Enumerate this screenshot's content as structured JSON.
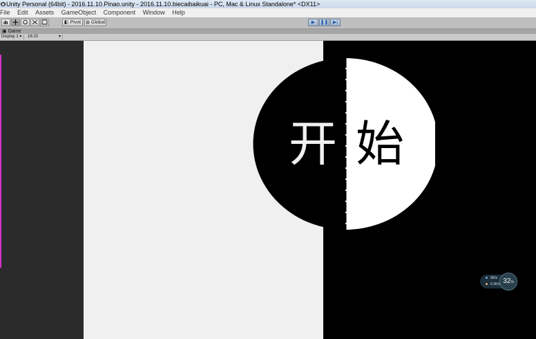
{
  "window": {
    "title": "Unity Personal (64bit) - 2016.11.10.Pinao.unity - 2016.11.10.biecaibaikuai - PC, Mac & Linux Standalone* <DX11>"
  },
  "menu": [
    "File",
    "Edit",
    "Assets",
    "GameObject",
    "Component",
    "Window",
    "Help"
  ],
  "toolbar": {
    "pivot_label": "Pivot",
    "global_label": "Global",
    "tools": [
      "hand-icon",
      "move-icon",
      "rotate-icon",
      "scale-icon",
      "rect-icon"
    ],
    "playback": [
      "play-icon",
      "pause-icon",
      "step-icon"
    ]
  },
  "game_view": {
    "tab_label": "Game",
    "display_label": "Display 1",
    "aspect_label": "16:10"
  },
  "scene": {
    "button_left_char": "开",
    "button_right_char": "始",
    "colors": {
      "dark": "#000000",
      "light": "#f0f0f0",
      "white": "#ffffff",
      "side_panel": "#2b2b2b",
      "accent_line": "#d431c8"
    }
  },
  "stats_widget": {
    "row1_value": "0",
    "row1_unit": "K/s",
    "row2_value": "0.3",
    "row2_unit": "K/s",
    "percent": "32",
    "percent_unit": "%"
  }
}
